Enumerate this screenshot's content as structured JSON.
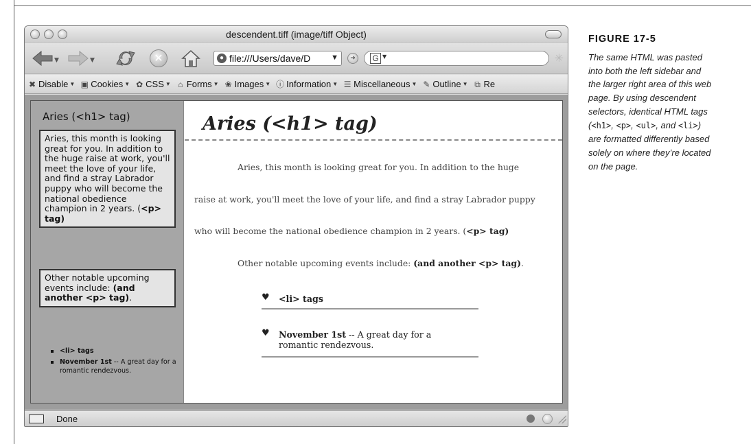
{
  "window": {
    "title": "descendent.tiff (image/tiff Object)",
    "url": "file:///Users/dave/D",
    "search_engine": "G",
    "status_text": "Done"
  },
  "devbar": {
    "items": [
      {
        "label": "Disable",
        "icon": "x-icon"
      },
      {
        "label": "Cookies",
        "icon": "cookie-icon"
      },
      {
        "label": "CSS",
        "icon": "css-icon"
      },
      {
        "label": "Forms",
        "icon": "forms-icon"
      },
      {
        "label": "Images",
        "icon": "images-icon"
      },
      {
        "label": "Information",
        "icon": "info-icon"
      },
      {
        "label": "Miscellaneous",
        "icon": "misc-icon"
      },
      {
        "label": "Outline",
        "icon": "pencil-icon"
      },
      {
        "label": "Re",
        "icon": "resize-icon"
      }
    ]
  },
  "sidebar": {
    "h1": "Aries (<h1> tag)",
    "p1_text": "Aries, this month is looking great for you. In addition to the huge raise at work, you'll meet the love of your life, and find a stray Labrador puppy who will become the national obedience champion in 2 years. (",
    "p1_tag": "<p> tag)",
    "p2_text": "Other notable upcoming events include: ",
    "p2_tag": "(and another <p> tag)",
    "p2_end": ".",
    "li1": "<li> tags",
    "li2_bold": "November 1st",
    "li2_rest": " -- A great day for a romantic rendezvous."
  },
  "main": {
    "h1": "Aries (<h1> tag)",
    "p1_line1": "Aries, this month is looking great for you. In addition to the huge",
    "p1_line2": "raise at work, you'll meet the love of your life, and find a stray Labrador puppy",
    "p1_line3_text": "who will become the national obedience champion in 2 years. (",
    "p1_line3_tag": "<p> tag)",
    "p2_text": "Other notable upcoming events include: ",
    "p2_tag": "(and another <p> tag)",
    "p2_end": ".",
    "li1": "<li> tags",
    "li2_bold": "November 1st",
    "li2_rest": " -- A great day for a",
    "li2_line2": "romantic rendezvous."
  },
  "caption": {
    "label": "FIGURE 17-5",
    "text_1": "The same HTML was pasted into both the left sidebar and the larger right area of this web page. By using descendent selectors, identical HTML tags (",
    "code_h1": "<h1>",
    "sep_1": ", ",
    "code_p": "<p>",
    "sep_2": ", ",
    "code_ul": "<ul>",
    "sep_3": ", and ",
    "code_li": "<li>",
    "text_2": ") are formatted differently based solely on where they’re located on the page."
  }
}
